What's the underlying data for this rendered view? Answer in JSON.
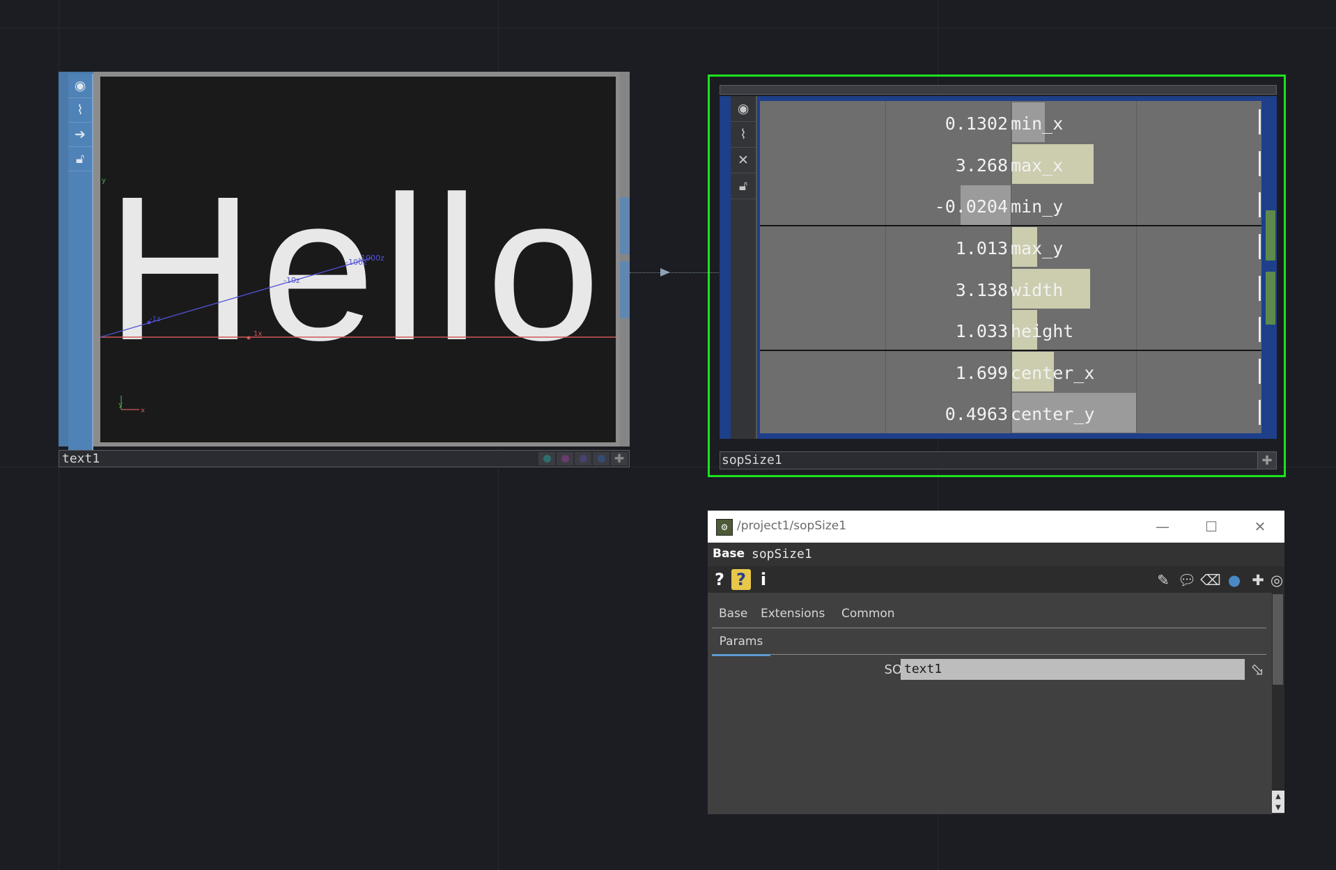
{
  "nodes": {
    "text1": {
      "name": "text1",
      "viewer_text": "Hello",
      "axis_labels": {
        "z_far": "-100z",
        "z_far2": "-1000z",
        "z_mid": "-10z",
        "z_near": "-1z",
        "x_near": "1x",
        "y_top": "y",
        "gizmo_y": "y",
        "gizmo_x": "x"
      }
    },
    "sopSize1": {
      "name": "sopSize1",
      "rows": [
        {
          "value": "0.1302",
          "name": "min_x"
        },
        {
          "value": "3.268",
          "name": "max_x"
        },
        {
          "value": "-0.0204",
          "name": "min_y"
        },
        {
          "value": "1.013",
          "name": "max_y"
        },
        {
          "value": "3.138",
          "name": "width"
        },
        {
          "value": "1.033",
          "name": "height"
        },
        {
          "value": "1.699",
          "name": "center_x"
        },
        {
          "value": "0.4963",
          "name": "center_y"
        }
      ]
    }
  },
  "dialog": {
    "path": "/project1/sopSize1",
    "type_label": "Base",
    "op_name": "sopSize1",
    "tool_left": [
      "?",
      "?",
      "i"
    ],
    "tabs": [
      "Base",
      "Extensions",
      "Common"
    ],
    "subtab": "Params",
    "param": {
      "label": "SOP",
      "value": "text1"
    }
  },
  "colors": {
    "selected_outline": "#1de31d",
    "text_node_side": "#4f82b6",
    "sop_frame": "#1e3f8a",
    "value_bar": "#ccccaf"
  }
}
